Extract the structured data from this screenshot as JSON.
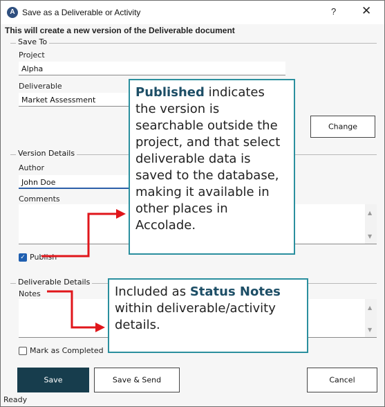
{
  "window": {
    "title": "Save as a Deliverable or Activity",
    "help": "?",
    "close": "✕",
    "intro": "This will create a new version of the Deliverable document"
  },
  "save_to": {
    "legend": "Save To",
    "project_label": "Project",
    "project_value": "Alpha",
    "deliverable_label": "Deliverable",
    "deliverable_value": "Market Assessment",
    "change_button": "Change"
  },
  "version_details": {
    "legend": "Version Details",
    "author_label": "Author",
    "author_value": "John Doe",
    "comments_label": "Comments",
    "publish_label": "Publish",
    "publish_checked": true
  },
  "deliverable_details": {
    "legend": "Deliverable Details",
    "notes_label": "Notes",
    "mark_completed_label": "Mark as Completed",
    "mark_completed_checked": false
  },
  "buttons": {
    "save": "Save",
    "save_send": "Save & Send",
    "cancel": "Cancel"
  },
  "status": "Ready",
  "callouts": {
    "published": {
      "bold": "Published",
      "rest": " indicates the version is searchable outside the project, and that select deliverable data is saved to the database, making it available in other places in Accolade."
    },
    "notes": {
      "pre": "Included as ",
      "bold": "Status Notes",
      "rest": " within deliverable/activity details."
    }
  },
  "colors": {
    "primary_button": "#173d4d",
    "callout_border": "#2a8f9e",
    "arrow": "#e0161b",
    "checkbox": "#1f5fb0"
  }
}
